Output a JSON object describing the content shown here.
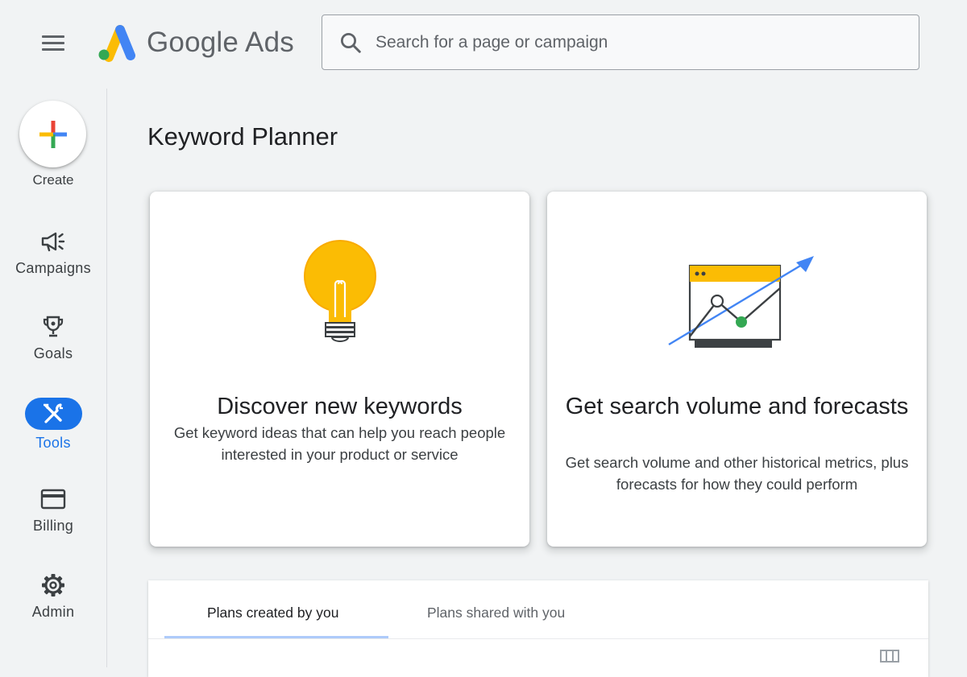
{
  "header": {
    "menu_icon": "hamburger-menu-icon",
    "logo_text": "Google Ads",
    "search_placeholder": "Search for a page or campaign",
    "search_icon": "search-icon"
  },
  "sidebar": {
    "create_label": "Create",
    "items": [
      {
        "label": "Campaigns",
        "icon": "megaphone-icon",
        "active": false
      },
      {
        "label": "Goals",
        "icon": "trophy-icon",
        "active": false
      },
      {
        "label": "Tools",
        "icon": "tools-icon",
        "active": true
      },
      {
        "label": "Billing",
        "icon": "credit-card-icon",
        "active": false
      },
      {
        "label": "Admin",
        "icon": "gear-icon",
        "active": false
      }
    ]
  },
  "main": {
    "page_title": "Keyword Planner",
    "cards": [
      {
        "title": "Discover new keywords",
        "description": "Get keyword ideas that can help you reach people interested in your product or service",
        "illustration": "lightbulb-icon"
      },
      {
        "title": "Get search volume and forecasts",
        "description": "Get search volume and other historical metrics, plus forecasts for how they could perform",
        "illustration": "trend-chart-icon"
      }
    ],
    "tabs": [
      {
        "label": "Plans created by you",
        "selected": true
      },
      {
        "label": "Plans shared with you",
        "selected": false
      }
    ]
  },
  "colors": {
    "accent": "#1a73e8",
    "google_blue": "#4285f4",
    "google_red": "#ea4335",
    "google_yellow": "#fbbc04",
    "google_green": "#34a853"
  }
}
